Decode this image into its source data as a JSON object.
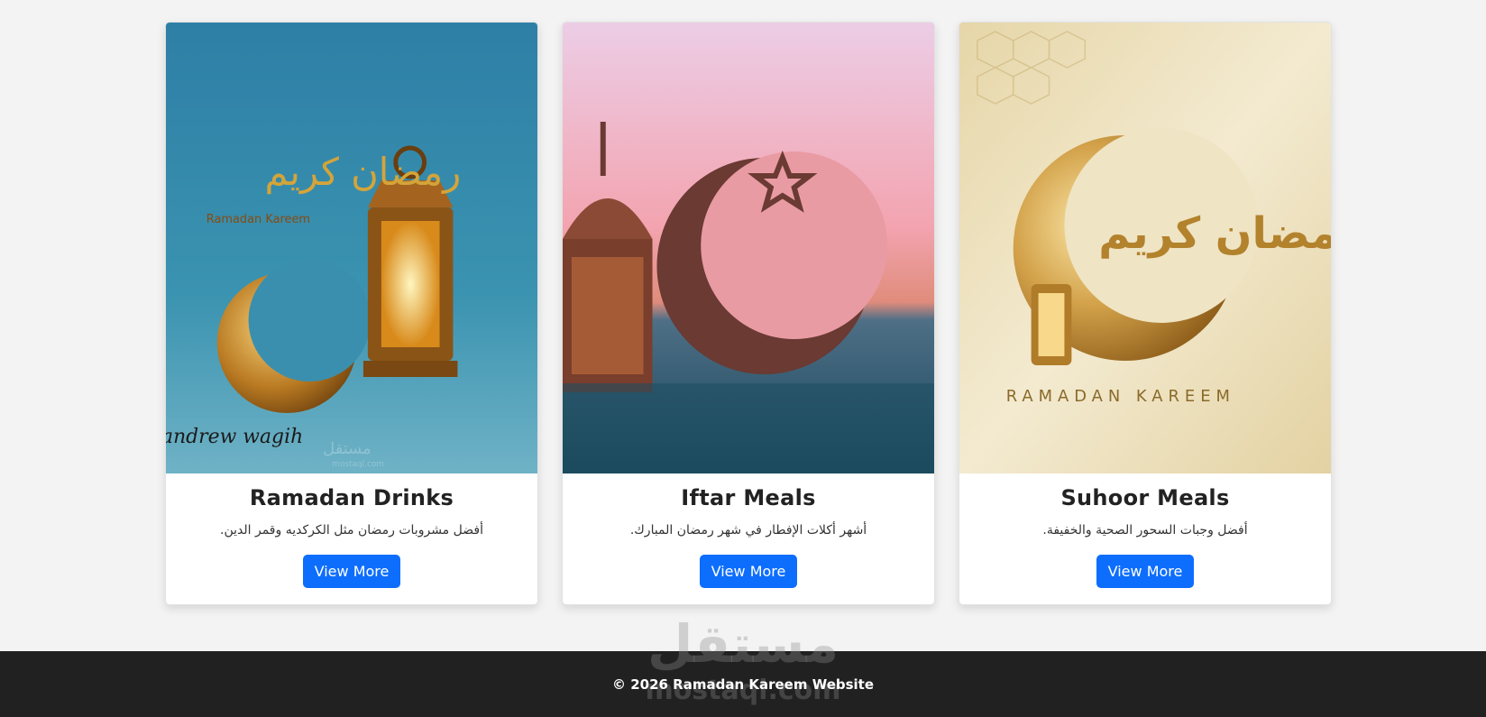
{
  "cards": [
    {
      "title": "Ramadan Drinks",
      "description": "أفضل مشروبات رمضان مثل الكركديه وقمر الدين.",
      "button_label": "View More",
      "image_text_1": "رمضان كريم",
      "image_text_2": "Ramadan Kareem",
      "image_text_3": "andrew wagih",
      "image_text_4": "مستقل",
      "image_text_5": "mostaql.com"
    },
    {
      "title": "Iftar Meals",
      "description": "أشهر أكلات الإفطار في شهر رمضان المبارك.",
      "button_label": "View More"
    },
    {
      "title": "Suhoor Meals",
      "description": "أفضل وجبات السحور الصحية والخفيفة.",
      "button_label": "View More",
      "image_text_1": "رمضان كريم",
      "image_text_2": "RAMADAN KAREEM"
    }
  ],
  "footer": {
    "text": "© 2026 Ramadan Kareem Website",
    "watermark_top": "مستقل",
    "watermark_bottom": "mostaql.com"
  },
  "colors": {
    "button": "#0d6efd",
    "footer_bg": "#212121",
    "page_bg": "#f3f3f3"
  }
}
